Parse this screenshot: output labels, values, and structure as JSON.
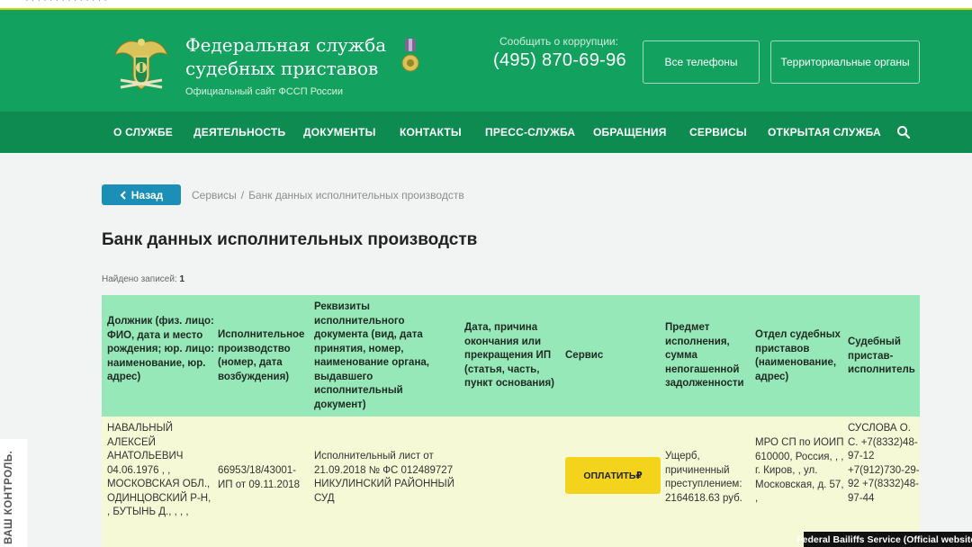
{
  "topstrip": {
    "partial_text": "· · ·  ·  ·  ·  ·  ·  ·  ·  ·  ·  ·  ·"
  },
  "header": {
    "title_line1": "Федеральная служба",
    "title_line2": "судебных приставов",
    "subtitle": "Официальный сайт ФССП России",
    "corruption_label": "Сообщить о коррупции:",
    "phone": "(495) 870-69-96",
    "btn_phones": "Все телефоны",
    "btn_territorial": "Территориальные органы"
  },
  "nav": {
    "items": [
      "О СЛУЖБЕ",
      "ДЕЯТЕЛЬНОСТЬ",
      "ДОКУМЕНТЫ",
      "КОНТАКТЫ",
      "ПРЕСС-СЛУЖБА",
      "ОБРАЩЕНИЯ",
      "СЕРВИСЫ",
      "ОТКРЫТАЯ СЛУЖБА"
    ]
  },
  "breadcrumb": {
    "back_label": "Назад",
    "items": [
      "Сервисы",
      "Банк данных исполнительных производств"
    ],
    "separator": "/"
  },
  "page": {
    "title": "Банк данных исполнительных производств",
    "found_label": "Найдено записей:",
    "found_count": "1"
  },
  "table": {
    "headers": [
      "Должник (физ. лицо: ФИО, дата и место рождения; юр. лицо: наименование, юр. адрес)",
      "Исполнительное производство (номер, дата возбуждения)",
      "Реквизиты исполнительного документа (вид, дата принятия, номер, наименование органа, выдавшего исполнительный документ)",
      "Дата, причина окончания или прекращения ИП (статья, часть, пункт основания)",
      "Сервис",
      "Предмет исполнения, сумма непогашенной задолженности",
      "Отдел судебных приставов (наименование, адрес)",
      "Судебный пристав-исполнитель"
    ],
    "row": {
      "debtor": "НАВАЛЬНЫЙ АЛЕКСЕЙ АНАТОЛЬЕВИЧ 04.06.1976 , , МОСКОВСКАЯ ОБЛ., ОДИНЦОВСКИЙ Р-Н, , БУТЫНЬ Д., , , ,",
      "proceeding": "66953/18/43001-ИП от 09.11.2018",
      "document": "Исполнительный лист от 21.09.2018 № ФС 012489727 НИКУЛИНСКИЙ РАЙОННЫЙ СУД",
      "end_reason": "",
      "pay_label": "ОПЛАТИТЬ₽",
      "subject": "Ущерб, причиненный преступлением: 2164618.63 руб.",
      "department": "МРО СП по ИОИП 610000, Россия, , , г. Киров, , ул. Московская, д. 57, ,",
      "bailiff": "СУСЛОВА О. С. +7(8332)48-97-12 +7(912)730-29-92 +7(8332)48-97-44"
    }
  },
  "watermark": {
    "side_text": "ВАШ КОНТРОЛЬ."
  },
  "caption": "Federal Bailiffs Service (Official website)",
  "colors": {
    "header_green": "#13a15f",
    "nav_green": "#0e8b50",
    "table_header": "#96e8b9",
    "row_bg": "#f5f9d6",
    "back_button": "#1b8fb5",
    "pay_button": "#f3d31b"
  },
  "icons": {
    "emblem": "fssp-eagle-emblem-icon",
    "medal": "medal-icon",
    "search": "search-icon",
    "back": "chevron-left-icon"
  }
}
